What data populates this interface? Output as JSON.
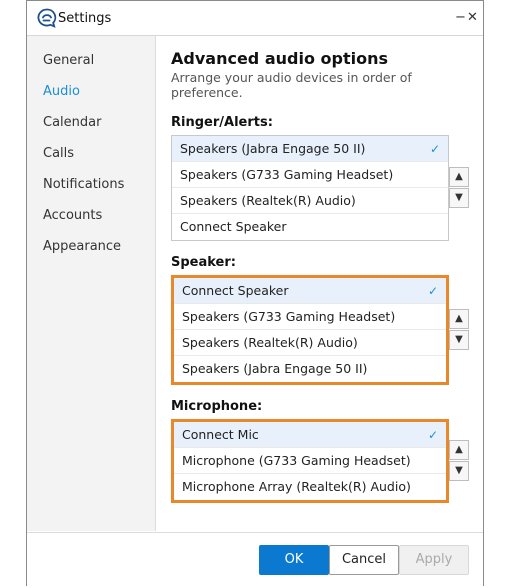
{
  "window": {
    "title": "Settings",
    "minimize_glyph": "−",
    "close_glyph": "✕"
  },
  "sidebar": {
    "items": [
      {
        "label": "General",
        "active": false
      },
      {
        "label": "Audio",
        "active": true
      },
      {
        "label": "Calendar",
        "active": false
      },
      {
        "label": "Calls",
        "active": false
      },
      {
        "label": "Notifications",
        "active": false
      },
      {
        "label": "Accounts",
        "active": false
      },
      {
        "label": "Appearance",
        "active": false
      }
    ]
  },
  "main": {
    "title": "Advanced audio options",
    "subtitle": "Arrange your audio devices in order of preference.",
    "ringer": {
      "label": "Ringer/Alerts:",
      "items": [
        "Speakers (Jabra Engage 50 II)",
        "Speakers (G733 Gaming Headset)",
        "Speakers (Realtek(R) Audio)",
        "Connect Speaker"
      ]
    },
    "speaker": {
      "label": "Speaker:",
      "items": [
        "Connect Speaker",
        "Speakers (G733 Gaming Headset)",
        "Speakers (Realtek(R) Audio)",
        "Speakers (Jabra Engage 50 II)"
      ]
    },
    "microphone": {
      "label": "Microphone:",
      "items": [
        "Connect Mic",
        "Microphone (G733 Gaming Headset)",
        "Microphone Array (Realtek(R) Audio)"
      ]
    },
    "check_glyph": "✓",
    "up_glyph": "▲",
    "down_glyph": "▼"
  },
  "footer": {
    "ok_label": "OK",
    "cancel_label": "Cancel",
    "apply_label": "Apply"
  },
  "colors": {
    "accent": "#1b8fd6",
    "focus_border": "#e8882a",
    "primary_button": "#0b79d0"
  },
  "icons": {
    "app": "chat-bubble-app-icon",
    "selected": "check-icon",
    "move_up": "arrow-up-icon",
    "move_down": "arrow-down-icon"
  }
}
